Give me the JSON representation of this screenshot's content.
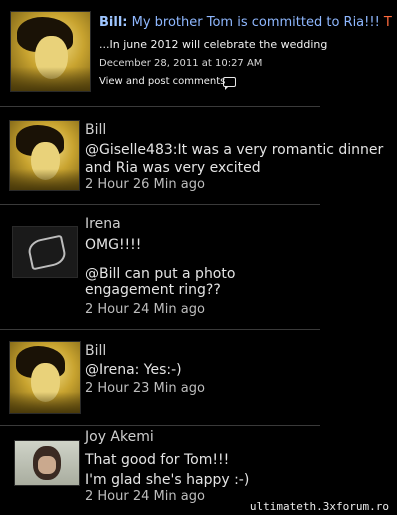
{
  "posts": [
    {
      "author": "Bill:",
      "headline": "My brother Tom is committed to Ria!!!",
      "headline_cut": " T",
      "sub": "...In june 2012 will celebrate the wedding",
      "date": "December 28, 2011 at 10:27 AM",
      "link": "View and post comments"
    },
    {
      "author": "Bill",
      "lines": [
        "@Giselle483:It was a very romantic dinner",
        "and Ria was very excited"
      ],
      "time": "2 Hour 26 Min ago"
    },
    {
      "author": "Irena",
      "lines": [
        "OMG!!!!",
        "",
        "@Bill can put a photo",
        "engagement ring??"
      ],
      "time": "2 Hour 24 Min ago"
    },
    {
      "author": "Bill",
      "lines": [
        "@Irena: Yes:-)"
      ],
      "time": "2 Hour 23 Min ago"
    },
    {
      "author": "Joy Akemi",
      "lines": [
        "That good for Tom!!!",
        "I'm glad she's happy :-)"
      ],
      "time": "2 Hour 24 Min ago"
    }
  ],
  "watermark": "ultimateth.3xforum.ro"
}
